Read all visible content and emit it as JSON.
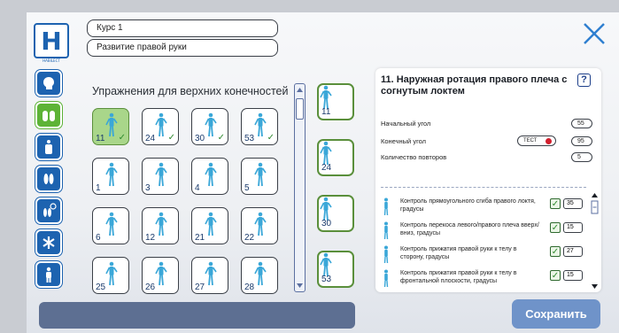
{
  "logo": {
    "letter": "H",
    "subtitle": "HABILECT"
  },
  "header": {
    "course": "Курс 1",
    "program": "Развитие правой руки"
  },
  "sidebar": {
    "items": [
      {
        "icon": "head-icon",
        "active": false
      },
      {
        "icon": "hands-icon",
        "active": true
      },
      {
        "icon": "body-icon",
        "active": false
      },
      {
        "icon": "feet-icon",
        "active": false
      },
      {
        "icon": "feet-timer-icon",
        "active": false
      },
      {
        "icon": "asterisk-icon",
        "active": false
      },
      {
        "icon": "person-icon",
        "active": false
      }
    ]
  },
  "exercises": {
    "title": "Упражнения для верхних конечностей",
    "tiles": [
      {
        "num": "11",
        "checked": true,
        "selected": true
      },
      {
        "num": "24",
        "checked": true,
        "selected": false
      },
      {
        "num": "30",
        "checked": true,
        "selected": false
      },
      {
        "num": "53",
        "checked": true,
        "selected": false
      },
      {
        "num": "1",
        "checked": false,
        "selected": false
      },
      {
        "num": "3",
        "checked": false,
        "selected": false
      },
      {
        "num": "4",
        "checked": false,
        "selected": false
      },
      {
        "num": "5",
        "checked": false,
        "selected": false
      },
      {
        "num": "6",
        "checked": false,
        "selected": false
      },
      {
        "num": "12",
        "checked": false,
        "selected": false
      },
      {
        "num": "21",
        "checked": false,
        "selected": false
      },
      {
        "num": "22",
        "checked": false,
        "selected": false
      },
      {
        "num": "25",
        "checked": false,
        "selected": false
      },
      {
        "num": "26",
        "checked": false,
        "selected": false
      },
      {
        "num": "27",
        "checked": false,
        "selected": false
      },
      {
        "num": "28",
        "checked": false,
        "selected": false
      }
    ]
  },
  "queue": [
    "11",
    "24",
    "30",
    "53"
  ],
  "details": {
    "title": "11. Наружная ротация правого плеча с согнутым локтем",
    "help": "?",
    "params": {
      "start_angle_label": "Начальный угол",
      "start_angle_value": "55",
      "end_angle_label": "Конечный угол",
      "test_label": "ТЕСТ",
      "end_angle_value": "95",
      "repeats_label": "Количество повторов",
      "repeats_value": "5"
    },
    "controls": [
      {
        "label": "Контроль прямоугольного сгиба правого локтя, градусы",
        "value": "35",
        "checked": true
      },
      {
        "label": "Контроль перекоса левого/правого плеча вверх/вниз, градусы",
        "value": "15",
        "checked": true
      },
      {
        "label": "Контроль прижатия правой руки к телу в сторону, градусы",
        "value": "27",
        "checked": true
      },
      {
        "label": "Контроль прижатия правой руки к телу в фронтальной плоскости, градусы",
        "value": "15",
        "checked": true
      }
    ]
  },
  "save_label": "Сохранить",
  "colors": {
    "brand": "#1d63b0",
    "active": "#5db336",
    "figure": "#3aa7d8",
    "save": "#6f93c9"
  }
}
